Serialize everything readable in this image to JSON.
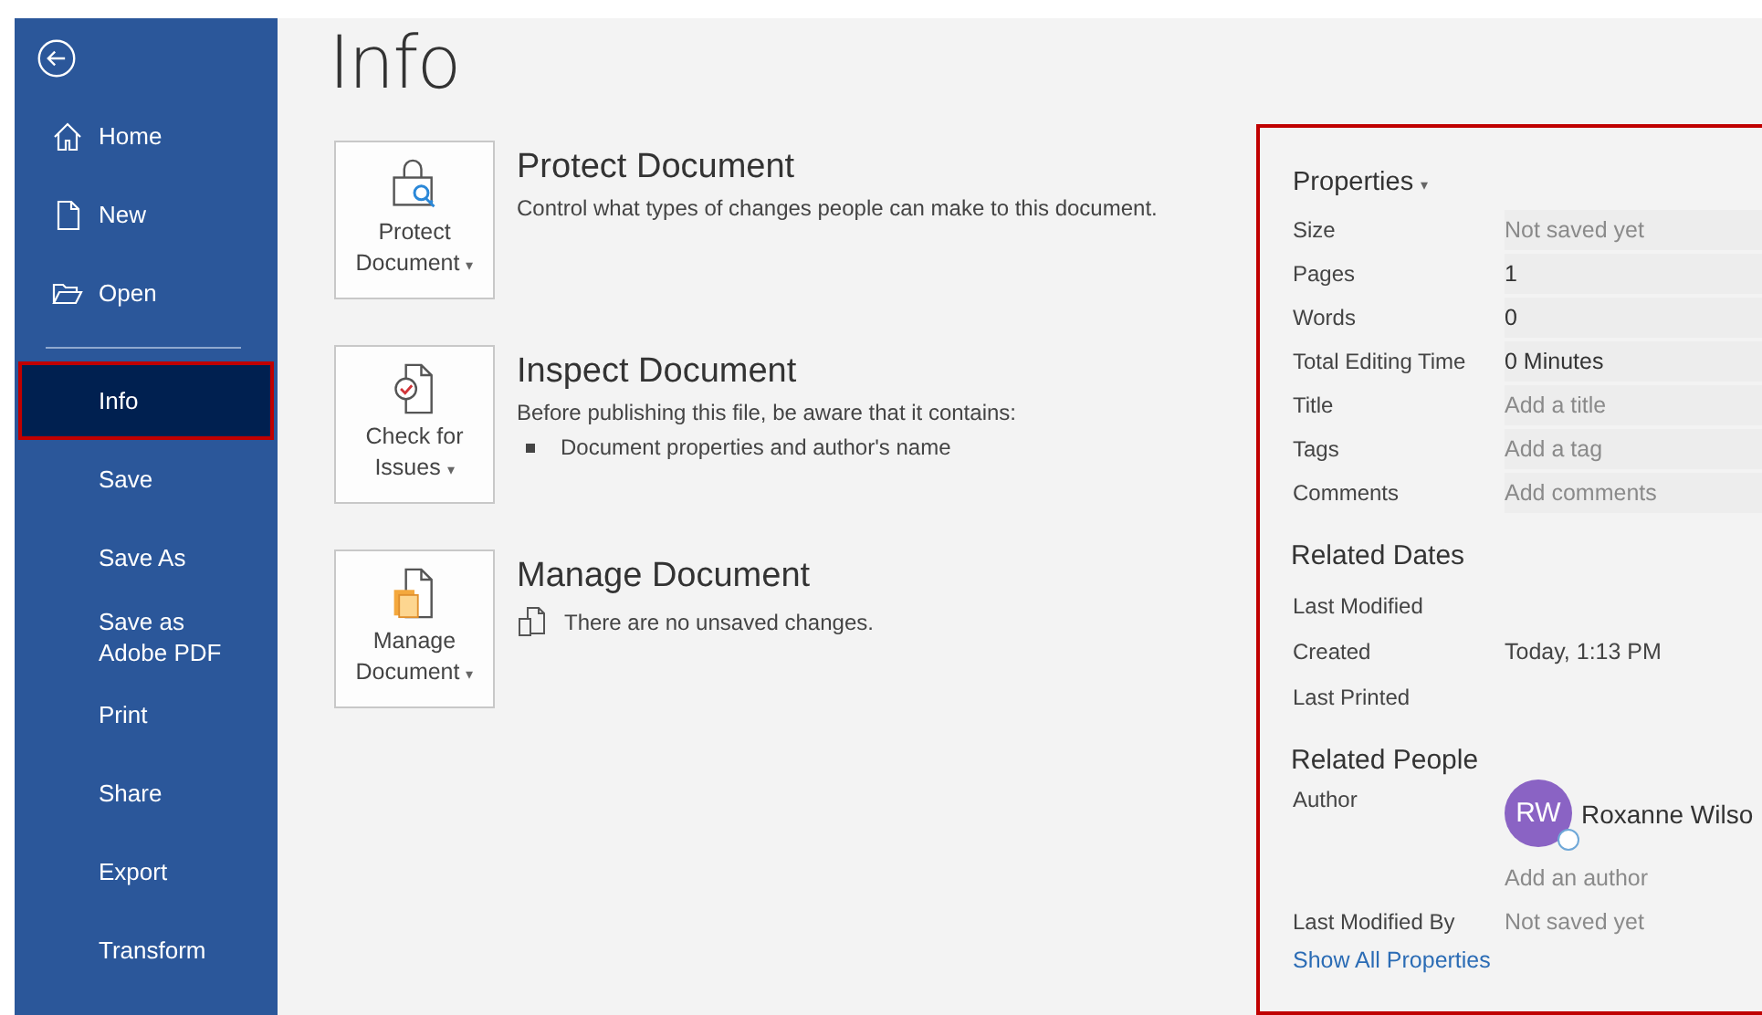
{
  "sidebar": {
    "items": [
      {
        "label": "Home",
        "kind": "home",
        "selected": false
      },
      {
        "label": "New",
        "kind": "new",
        "selected": false
      },
      {
        "label": "Open",
        "kind": "open",
        "selected": false
      },
      {
        "label": "Info",
        "selected": true,
        "divider_before": true
      },
      {
        "label": "Save",
        "selected": false
      },
      {
        "label": "Save As",
        "selected": false
      },
      {
        "label": "Save as Adobe PDF",
        "selected": false
      },
      {
        "label": "Print",
        "selected": false
      },
      {
        "label": "Share",
        "selected": false
      },
      {
        "label": "Export",
        "selected": false
      },
      {
        "label": "Transform",
        "selected": false
      }
    ]
  },
  "page_title": "Info",
  "sections": [
    {
      "kind": "protect",
      "button": [
        "Protect",
        "Document"
      ],
      "caret": "▾",
      "title": "Protect Document",
      "text": "Control what types of changes people can make to this document."
    },
    {
      "kind": "inspect",
      "button": [
        "Check for",
        "Issues"
      ],
      "caret": "▾",
      "title": "Inspect Document",
      "text": "Before publishing this file, be aware that it contains:",
      "bullets": [
        "Document properties and author's name"
      ]
    },
    {
      "kind": "manage",
      "button": [
        "Manage",
        "Document"
      ],
      "caret": "▾",
      "title": "Manage Document",
      "note": "There are no unsaved changes."
    }
  ],
  "properties": {
    "title": "Properties",
    "caret": "▾",
    "rows": [
      {
        "label": "Size",
        "value": "Not saved yet",
        "muted": true
      },
      {
        "label": "Pages",
        "value": "1",
        "muted": false
      },
      {
        "label": "Words",
        "value": "0",
        "muted": false
      },
      {
        "label": "Total Editing Time",
        "value": "0 Minutes",
        "muted": false
      },
      {
        "label": "Title",
        "value": "Add a title",
        "muted": true
      },
      {
        "label": "Tags",
        "value": "Add a tag",
        "muted": true
      },
      {
        "label": "Comments",
        "value": "Add comments",
        "muted": true
      }
    ],
    "related_dates": {
      "title": "Related Dates",
      "rows": [
        {
          "label": "Last Modified"
        },
        {
          "label": "Created",
          "value": "Today, 1:13 PM"
        },
        {
          "label": "Last Printed"
        }
      ]
    },
    "related_people": {
      "title": "Related People",
      "author_label": "Author",
      "author_initials": "RW",
      "author_name": "Roxanne Wilso",
      "add_author": "Add an author",
      "last_modified_by_label": "Last Modified By",
      "last_modified_by": "Not saved yet"
    },
    "link": "Show All Properties"
  }
}
